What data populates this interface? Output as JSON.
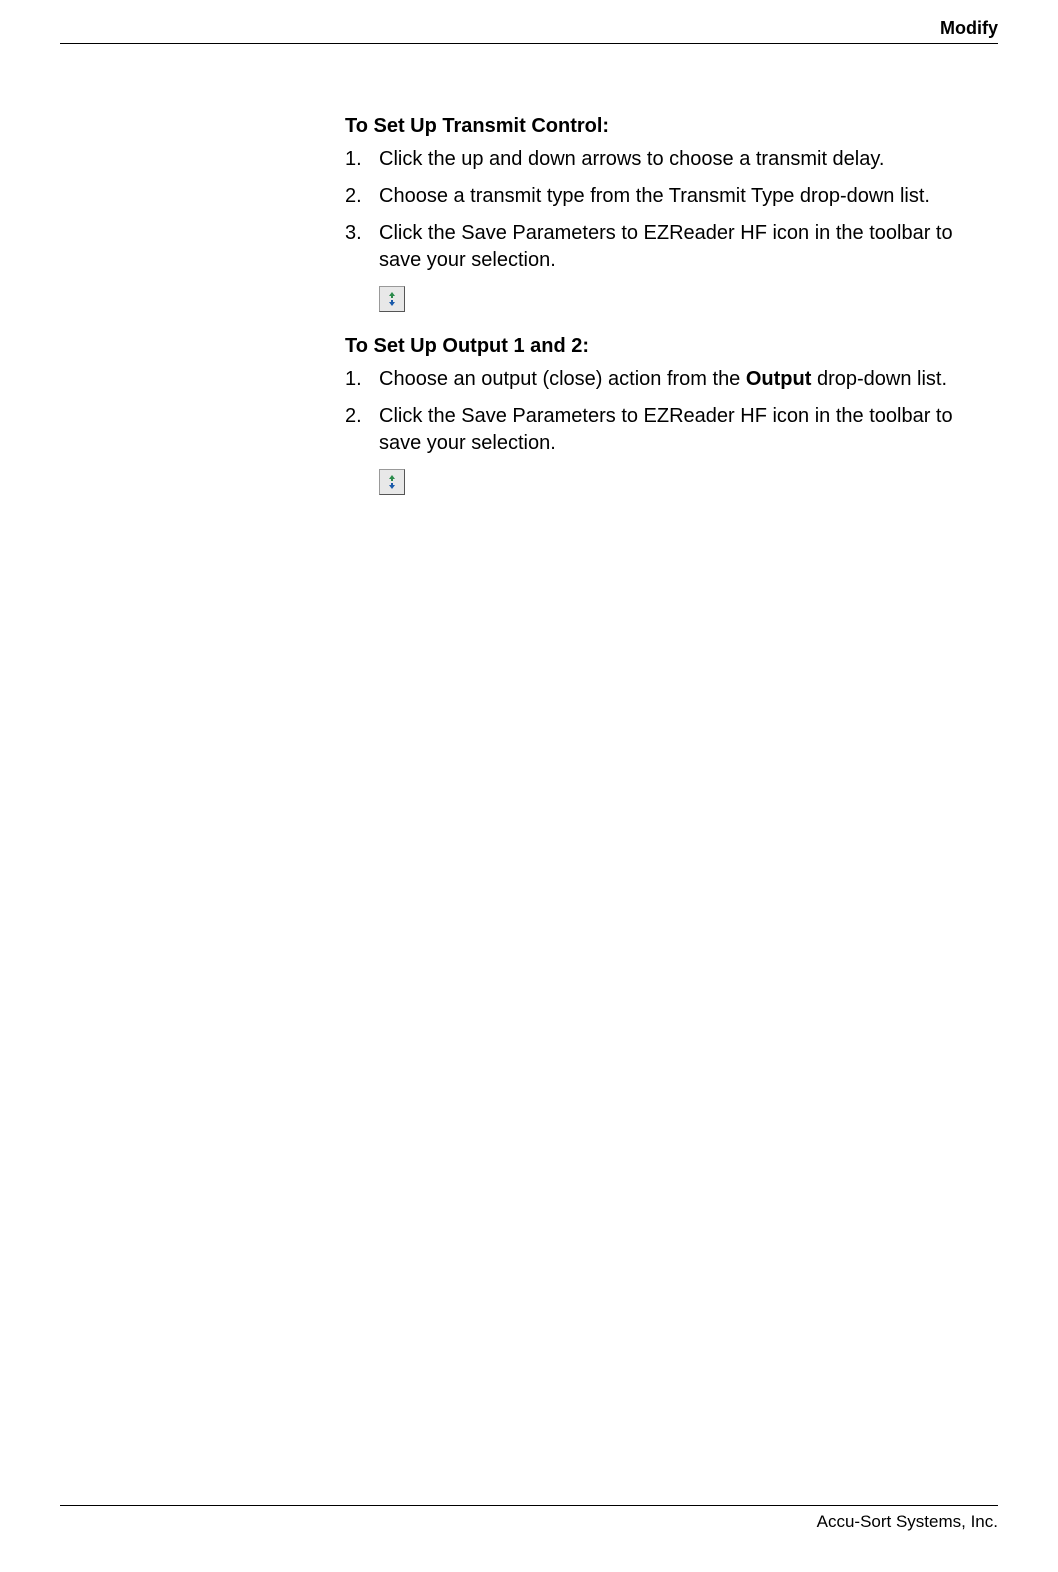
{
  "header": {
    "title": "Modify"
  },
  "sections": [
    {
      "heading": "To Set Up Transmit Control:",
      "steps": [
        {
          "num": "1.",
          "text": "Click the up and down arrows to choose a transmit delay."
        },
        {
          "num": "2.",
          "text": "Choose a transmit type from the Transmit Type drop-down list."
        },
        {
          "num": "3.",
          "text": "Click the Save Parameters to EZReader HF icon in the toolbar to save your selection."
        }
      ],
      "icon": "save-parameters-icon"
    },
    {
      "heading": "To Set Up Output 1 and 2:",
      "steps": [
        {
          "num": "1.",
          "pre": "Choose an output (close) action from the ",
          "bold": "Output",
          "post": " drop-down list."
        },
        {
          "num": "2.",
          "text": "Click the Save Parameters to EZReader HF icon in the toolbar to save your selection."
        }
      ],
      "icon": "save-parameters-icon"
    }
  ],
  "footer": {
    "company": "Accu-Sort Systems, Inc."
  }
}
